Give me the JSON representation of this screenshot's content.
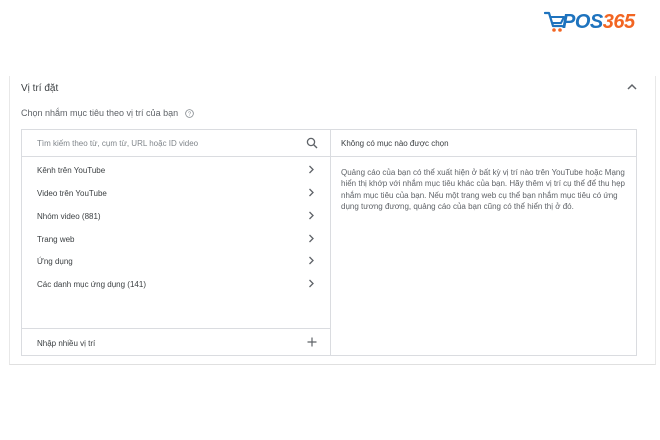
{
  "brand": {
    "logo_text": "POS365",
    "color_a": "#1e73be",
    "color_b": "#f26522"
  },
  "panel": {
    "title": "Vị trí đặt",
    "subtitle": "Chọn nhắm mục tiêu theo vị trí của bạn"
  },
  "search": {
    "placeholder": "Tìm kiếm theo từ, cụm từ, URL hoặc ID video"
  },
  "items": [
    {
      "label": "Kênh trên YouTube"
    },
    {
      "label": "Video trên YouTube"
    },
    {
      "label": "Nhóm video (881)"
    },
    {
      "label": "Trang web"
    },
    {
      "label": "Ứng dụng"
    },
    {
      "label": "Các danh mục ứng dụng (141)"
    }
  ],
  "bottom": {
    "label": "Nhập nhiều vị trí"
  },
  "right": {
    "title": "Không có mục nào được chọn",
    "body": "Quảng cáo của bạn có thể xuất hiện ở bất kỳ vị trí nào trên YouTube hoặc Mạng hiển thị khớp với nhắm mục tiêu khác của bạn. Hãy thêm vị trí cụ thể để thu hẹp nhắm mục tiêu của bạn. Nếu một trang web cụ thể bạn nhắm mục tiêu có ứng dụng tương đương, quảng cáo của bạn cũng có thể hiển thị ở đó."
  },
  "icons": {
    "collapse": "chevron-up-icon",
    "help": "help-circle-icon",
    "search": "search-icon",
    "item": "chevron-right-icon",
    "add": "plus-icon",
    "logo": "cart-icon"
  }
}
